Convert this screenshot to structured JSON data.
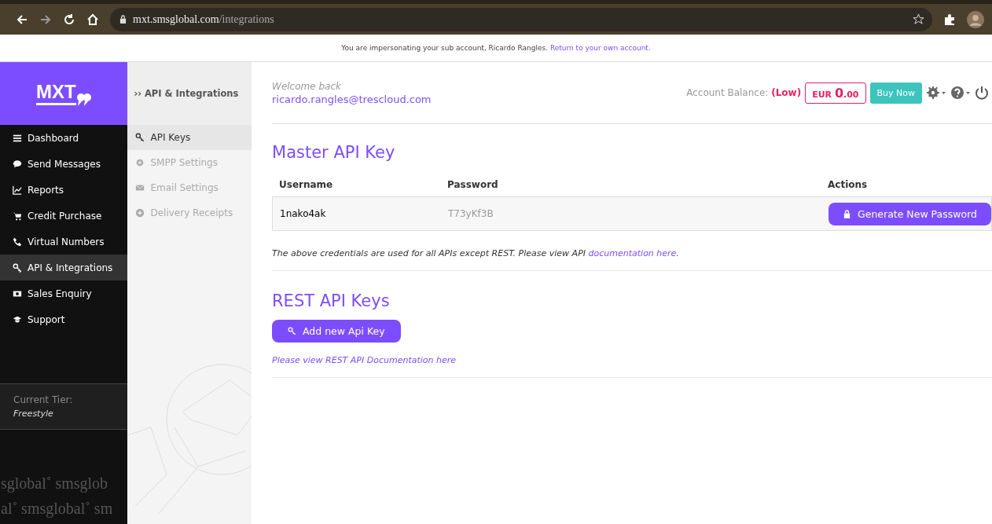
{
  "browser": {
    "url_host": "mxt.smsglobal.com",
    "url_path": "/integrations"
  },
  "notice": {
    "text": "You are impersonating your sub account, Ricardo Rangles.",
    "link": "Return to your own account."
  },
  "logo": {
    "text": "MXT"
  },
  "breadcrumb": {
    "marker": "››",
    "title": "API & Integrations"
  },
  "sidebar": {
    "items": [
      {
        "label": "Dashboard",
        "selected": false
      },
      {
        "label": "Send Messages",
        "selected": false
      },
      {
        "label": "Reports",
        "selected": false
      },
      {
        "label": "Credit Purchase",
        "selected": false
      },
      {
        "label": "Virtual Numbers",
        "selected": false
      },
      {
        "label": "API & Integrations",
        "selected": true
      },
      {
        "label": "Sales Enquiry",
        "selected": false
      },
      {
        "label": "Support",
        "selected": false
      }
    ],
    "tier_label": "Current Tier:",
    "tier_value": "Freestyle",
    "pattern_lines": [
      "sglobal˚ smsglob",
      "al˚ smsglobal˚ sm"
    ]
  },
  "submenu": [
    {
      "label": "API Keys",
      "selected": true,
      "disabled": false
    },
    {
      "label": "SMPP Settings",
      "selected": false,
      "disabled": true
    },
    {
      "label": "Email Settings",
      "selected": false,
      "disabled": true
    },
    {
      "label": "Delivery Receipts",
      "selected": false,
      "disabled": true
    }
  ],
  "header": {
    "welcome": "Welcome back",
    "email": "ricardo.rangles@trescloud.com",
    "balance_label": "Account Balance:",
    "balance_status": "(Low)",
    "currency": "EUR",
    "amount_main": "0",
    "amount_cents": ".00",
    "buy_button": "Buy Now"
  },
  "master": {
    "title": "Master API Key",
    "columns": [
      "Username",
      "Password",
      "Actions"
    ],
    "rows": [
      {
        "username": "1nako4ak",
        "password": "T73yKf3B",
        "action": "Generate New Password"
      }
    ],
    "note": "The above credentials are used for all APIs except REST. Please view API",
    "note_link": "documentation here",
    "note_end": "."
  },
  "rest": {
    "title": "REST API Keys",
    "button": "Add new Api Key",
    "link": "Please view REST API Documentation here"
  }
}
